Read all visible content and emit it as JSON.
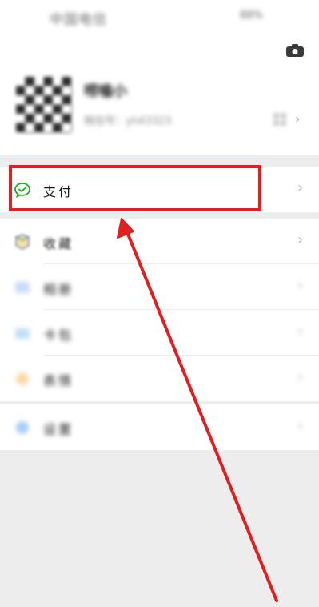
{
  "status_bar": {
    "carrier": "中国电信",
    "battery": "88%"
  },
  "profile": {
    "nickname": "唠嗑小",
    "wechat_id": "微信号：yh43323"
  },
  "menu": [
    {
      "label": "支付",
      "icon": "wechat-pay-icon",
      "color": "#1aad19"
    },
    {
      "label": "收藏",
      "icon": "favorites-icon",
      "color": "#f2b230"
    },
    {
      "label": "相册",
      "icon": "album-icon",
      "color": "#5b8cf0"
    },
    {
      "label": "卡包",
      "icon": "card-wallet-icon",
      "color": "#4da3f0"
    },
    {
      "label": "表情",
      "icon": "sticker-icon",
      "color": "#f2a33a"
    },
    {
      "label": "设置",
      "icon": "settings-icon",
      "color": "#3e8ef7"
    }
  ],
  "annotation": {
    "color": "#e02020"
  }
}
